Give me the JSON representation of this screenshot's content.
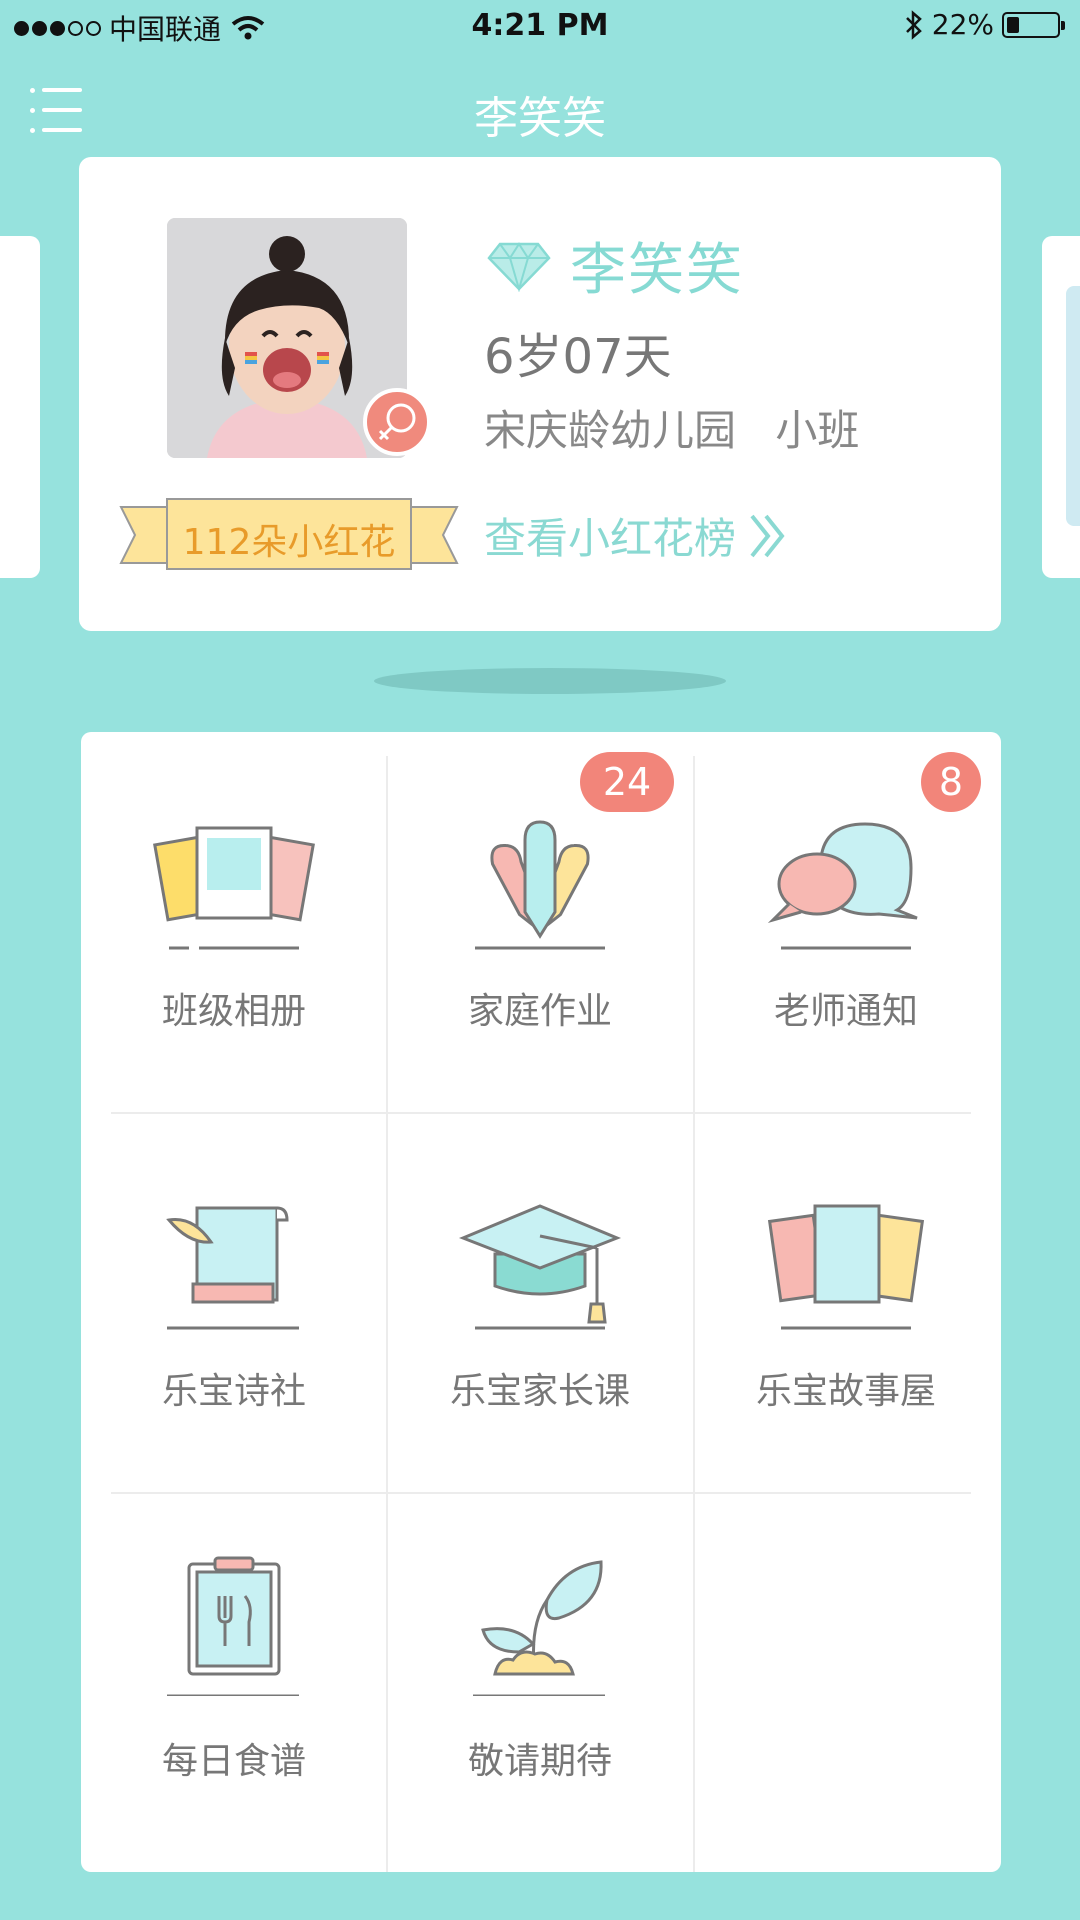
{
  "status_bar": {
    "carrier": "中国联通",
    "time": "4:21 PM",
    "battery": "22%",
    "battery_level": 0.22
  },
  "nav": {
    "title": "李笑笑",
    "menu_icon": "menu-icon"
  },
  "profile": {
    "name": "李笑笑",
    "age": "6岁07天",
    "school": "宋庆龄幼儿园",
    "class": "小班",
    "flowers": "112朵小红花",
    "rank_link": "查看小红花榜",
    "gender_icon": "female-icon",
    "level_icon": "diamond-icon"
  },
  "grid": {
    "items": [
      {
        "label": "班级相册",
        "icon": "photo-album-icon",
        "badge": ""
      },
      {
        "label": "家庭作业",
        "icon": "pencils-icon",
        "badge": "24"
      },
      {
        "label": "老师通知",
        "icon": "chat-bubbles-icon",
        "badge": "8"
      },
      {
        "label": "乐宝诗社",
        "icon": "scroll-quill-icon",
        "badge": ""
      },
      {
        "label": "乐宝家长课",
        "icon": "graduation-cap-icon",
        "badge": ""
      },
      {
        "label": "乐宝故事屋",
        "icon": "books-icon",
        "badge": ""
      },
      {
        "label": "每日食谱",
        "icon": "clipboard-fork-icon",
        "badge": ""
      },
      {
        "label": "敬请期待",
        "icon": "sprout-icon",
        "badge": ""
      }
    ]
  },
  "colors": {
    "background": "#96e2dd",
    "accent": "#86dad3",
    "badge": "#f2857a",
    "ribbon": "#fde49a",
    "flower_text": "#e89b2a"
  }
}
